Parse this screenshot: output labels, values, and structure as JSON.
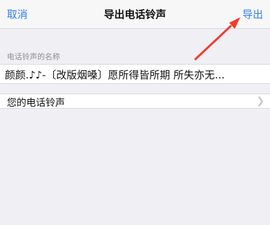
{
  "navbar": {
    "cancel_label": "取消",
    "title": "导出电话铃声",
    "export_label": "导出"
  },
  "name_section": {
    "header": "电话铃声的名称",
    "value": "颜颜.♪♪-〔改版烟嗓〕愿所得皆所期 所失亦无..."
  },
  "ringtone_section": {
    "label": "您的电话铃声"
  },
  "icons": [
    "chevron-right-icon",
    "red-arrow-annotation"
  ],
  "colors": {
    "accent": "#2f7cf6",
    "background": "#efeff4",
    "annotation_arrow": "#f23a2e"
  }
}
